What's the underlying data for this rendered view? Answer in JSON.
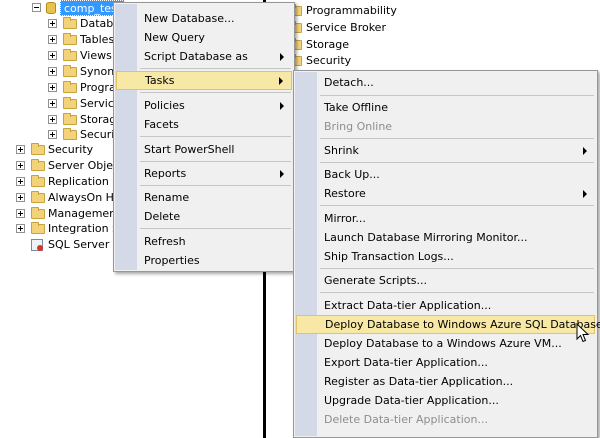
{
  "left_tree": {
    "selected_db": "comp_test",
    "db_children": [
      "Databa",
      "Tables",
      "Views",
      "Synony",
      "Progra",
      "Service",
      "Storage",
      "Security"
    ],
    "server_nodes": [
      "Security",
      "Server Objects",
      "Replication",
      "AlwaysOn High",
      "Management",
      "Integration Ser"
    ],
    "agent": "SQL Server Age"
  },
  "right_tree": [
    "Programmability",
    "Service Broker",
    "Storage",
    "Security"
  ],
  "context_menu": {
    "items": [
      {
        "label": "New Database...",
        "submenu": false,
        "highlighted": false
      },
      {
        "label": "New Query",
        "submenu": false,
        "highlighted": false
      },
      {
        "label": "Script Database as",
        "submenu": true,
        "highlighted": false
      },
      {
        "label": "Tasks",
        "submenu": true,
        "highlighted": true
      },
      {
        "label": "Policies",
        "submenu": true,
        "highlighted": false
      },
      {
        "label": "Facets",
        "submenu": false,
        "highlighted": false
      },
      {
        "label": "Start PowerShell",
        "submenu": false,
        "highlighted": false
      },
      {
        "label": "Reports",
        "submenu": true,
        "highlighted": false
      },
      {
        "label": "Rename",
        "submenu": false,
        "highlighted": false
      },
      {
        "label": "Delete",
        "submenu": false,
        "highlighted": false
      },
      {
        "label": "Refresh",
        "submenu": false,
        "highlighted": false
      },
      {
        "label": "Properties",
        "submenu": false,
        "highlighted": false
      }
    ]
  },
  "tasks_menu": {
    "items": [
      {
        "label": "Detach...",
        "submenu": false,
        "disabled": false
      },
      {
        "label": "Take Offline",
        "submenu": false,
        "disabled": false
      },
      {
        "label": "Bring Online",
        "submenu": false,
        "disabled": true
      },
      {
        "label": "Shrink",
        "submenu": true,
        "disabled": false
      },
      {
        "label": "Back Up...",
        "submenu": false,
        "disabled": false
      },
      {
        "label": "Restore",
        "submenu": true,
        "disabled": false
      },
      {
        "label": "Mirror...",
        "submenu": false,
        "disabled": false
      },
      {
        "label": "Launch Database Mirroring Monitor...",
        "submenu": false,
        "disabled": false
      },
      {
        "label": "Ship Transaction Logs...",
        "submenu": false,
        "disabled": false
      },
      {
        "label": "Generate Scripts...",
        "submenu": false,
        "disabled": false
      },
      {
        "label": "Extract Data-tier Application...",
        "submenu": false,
        "disabled": false
      },
      {
        "label": "Deploy Database to Windows Azure SQL Database...",
        "submenu": false,
        "disabled": false,
        "highlighted": true
      },
      {
        "label": "Deploy Database to a Windows Azure VM...",
        "submenu": false,
        "disabled": false
      },
      {
        "label": "Export Data-tier Application...",
        "submenu": false,
        "disabled": false
      },
      {
        "label": "Register as Data-tier Application...",
        "submenu": false,
        "disabled": false
      },
      {
        "label": "Upgrade Data-tier Application...",
        "submenu": false,
        "disabled": false
      },
      {
        "label": "Delete Data-tier Application...",
        "submenu": false,
        "disabled": true
      }
    ]
  },
  "colors": {
    "menu_bg": "#f0f0f0",
    "gutter": "#d4d9e7",
    "highlight": "#f8e8a6",
    "selection": "#3399ff"
  }
}
